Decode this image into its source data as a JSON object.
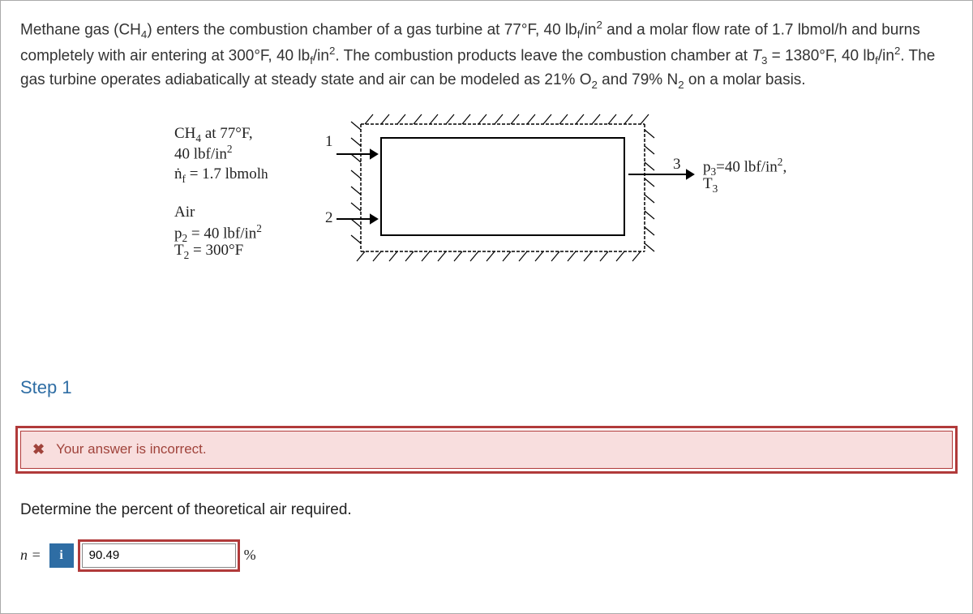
{
  "problem": {
    "html": "Methane gas (CH<sub>4</sub>) enters the combustion chamber of a gas turbine at 77°F, 40 lb<sub>f</sub>/in<sup>2</sup> and a molar flow rate of 1.7 lbmol/h and burns completely with air entering at 300°F, 40 lb<sub>f</sub>/in<sup>2</sup>. The combustion products leave the combustion chamber at <i>T</i><sub>3</sub> = 1380°F, 40 lb<sub>f</sub>/in<sup>2</sup>. The gas turbine operates adiabatically at steady state and air can be modeled as 21% O<sub>2</sub> and 79% N<sub>2</sub> on a molar basis."
  },
  "figure": {
    "stream1": {
      "line1_html": "CH<sub>4</sub> at 77°F,",
      "line2_html": "40 lbf/in<sup>2</sup>",
      "line3_html": "ṅ<sub>f</sub> = 1.7 lbmol<span style='font-size:0.9em'>h</span>",
      "num": "1"
    },
    "stream2": {
      "line1": "Air",
      "line2_html": "p<sub>2</sub> = 40 lbf/in<sup>2</sup>",
      "line3_html": "T<sub>2</sub> = 300°F",
      "num": "2"
    },
    "stream3": {
      "line1_html": "p<sub>3</sub>=40 lbf/in<sup>2</sup>,",
      "line2_html": "T<sub>3</sub>",
      "num": "3"
    }
  },
  "step": {
    "title": "Step 1"
  },
  "feedback": {
    "text": "Your answer is incorrect."
  },
  "question": {
    "text": "Determine the percent of theoretical air required."
  },
  "answer": {
    "var_html": "<i>n</i> =",
    "value": "90.49",
    "unit": "%"
  }
}
